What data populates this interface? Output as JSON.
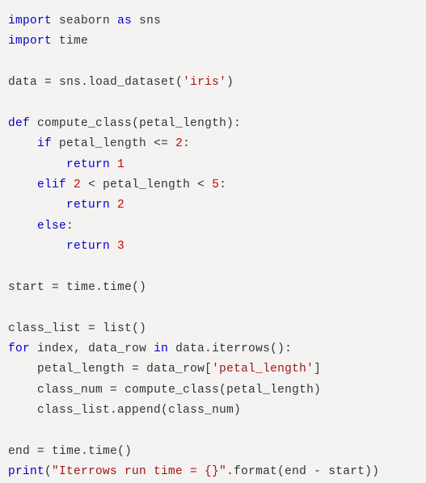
{
  "code": {
    "lines": [
      {
        "indent": 0,
        "tokens": [
          {
            "t": "kw",
            "v": "import"
          },
          {
            "t": "sp",
            "v": " "
          },
          {
            "t": "id",
            "v": "seaborn"
          },
          {
            "t": "sp",
            "v": " "
          },
          {
            "t": "kw",
            "v": "as"
          },
          {
            "t": "sp",
            "v": " "
          },
          {
            "t": "id",
            "v": "sns"
          }
        ]
      },
      {
        "indent": 0,
        "tokens": [
          {
            "t": "kw",
            "v": "import"
          },
          {
            "t": "sp",
            "v": " "
          },
          {
            "t": "id",
            "v": "time"
          }
        ]
      },
      {
        "blank": true
      },
      {
        "indent": 0,
        "tokens": [
          {
            "t": "id",
            "v": "data"
          },
          {
            "t": "sp",
            "v": " "
          },
          {
            "t": "op",
            "v": "="
          },
          {
            "t": "sp",
            "v": " "
          },
          {
            "t": "id",
            "v": "sns.load_dataset"
          },
          {
            "t": "op",
            "v": "("
          },
          {
            "t": "str",
            "v": "'iris'"
          },
          {
            "t": "op",
            "v": ")"
          }
        ]
      },
      {
        "blank": true
      },
      {
        "indent": 0,
        "tokens": [
          {
            "t": "kw",
            "v": "def"
          },
          {
            "t": "sp",
            "v": " "
          },
          {
            "t": "id",
            "v": "compute_class"
          },
          {
            "t": "op",
            "v": "("
          },
          {
            "t": "id",
            "v": "petal_length"
          },
          {
            "t": "op",
            "v": "):"
          }
        ]
      },
      {
        "indent": 1,
        "tokens": [
          {
            "t": "kw",
            "v": "if"
          },
          {
            "t": "sp",
            "v": " "
          },
          {
            "t": "id",
            "v": "petal_length"
          },
          {
            "t": "sp",
            "v": " "
          },
          {
            "t": "op",
            "v": "<="
          },
          {
            "t": "sp",
            "v": " "
          },
          {
            "t": "num",
            "v": "2"
          },
          {
            "t": "op",
            "v": ":"
          }
        ]
      },
      {
        "indent": 2,
        "tokens": [
          {
            "t": "kw",
            "v": "return"
          },
          {
            "t": "sp",
            "v": " "
          },
          {
            "t": "num",
            "v": "1"
          }
        ]
      },
      {
        "indent": 1,
        "tokens": [
          {
            "t": "kw",
            "v": "elif"
          },
          {
            "t": "sp",
            "v": " "
          },
          {
            "t": "num",
            "v": "2"
          },
          {
            "t": "sp",
            "v": " "
          },
          {
            "t": "op",
            "v": "<"
          },
          {
            "t": "sp",
            "v": " "
          },
          {
            "t": "id",
            "v": "petal_length"
          },
          {
            "t": "sp",
            "v": " "
          },
          {
            "t": "op",
            "v": "<"
          },
          {
            "t": "sp",
            "v": " "
          },
          {
            "t": "num",
            "v": "5"
          },
          {
            "t": "op",
            "v": ":"
          }
        ]
      },
      {
        "indent": 2,
        "tokens": [
          {
            "t": "kw",
            "v": "return"
          },
          {
            "t": "sp",
            "v": " "
          },
          {
            "t": "num",
            "v": "2"
          }
        ]
      },
      {
        "indent": 1,
        "tokens": [
          {
            "t": "kw",
            "v": "else"
          },
          {
            "t": "op",
            "v": ":"
          }
        ]
      },
      {
        "indent": 2,
        "tokens": [
          {
            "t": "kw",
            "v": "return"
          },
          {
            "t": "sp",
            "v": " "
          },
          {
            "t": "num",
            "v": "3"
          }
        ]
      },
      {
        "blank": true
      },
      {
        "indent": 0,
        "tokens": [
          {
            "t": "id",
            "v": "start"
          },
          {
            "t": "sp",
            "v": " "
          },
          {
            "t": "op",
            "v": "="
          },
          {
            "t": "sp",
            "v": " "
          },
          {
            "t": "id",
            "v": "time.time"
          },
          {
            "t": "op",
            "v": "()"
          }
        ]
      },
      {
        "blank": true
      },
      {
        "indent": 0,
        "tokens": [
          {
            "t": "id",
            "v": "class_list"
          },
          {
            "t": "sp",
            "v": " "
          },
          {
            "t": "op",
            "v": "="
          },
          {
            "t": "sp",
            "v": " "
          },
          {
            "t": "id",
            "v": "list"
          },
          {
            "t": "op",
            "v": "()"
          }
        ]
      },
      {
        "indent": 0,
        "tokens": [
          {
            "t": "kw",
            "v": "for"
          },
          {
            "t": "sp",
            "v": " "
          },
          {
            "t": "id",
            "v": "index"
          },
          {
            "t": "op",
            "v": ","
          },
          {
            "t": "sp",
            "v": " "
          },
          {
            "t": "id",
            "v": "data_row"
          },
          {
            "t": "sp",
            "v": " "
          },
          {
            "t": "kw",
            "v": "in"
          },
          {
            "t": "sp",
            "v": " "
          },
          {
            "t": "id",
            "v": "data.iterrows"
          },
          {
            "t": "op",
            "v": "():"
          }
        ]
      },
      {
        "indent": 1,
        "tokens": [
          {
            "t": "id",
            "v": "petal_length"
          },
          {
            "t": "sp",
            "v": " "
          },
          {
            "t": "op",
            "v": "="
          },
          {
            "t": "sp",
            "v": " "
          },
          {
            "t": "id",
            "v": "data_row"
          },
          {
            "t": "op",
            "v": "["
          },
          {
            "t": "str",
            "v": "'petal_length'"
          },
          {
            "t": "op",
            "v": "]"
          }
        ]
      },
      {
        "indent": 1,
        "tokens": [
          {
            "t": "id",
            "v": "class_num"
          },
          {
            "t": "sp",
            "v": " "
          },
          {
            "t": "op",
            "v": "="
          },
          {
            "t": "sp",
            "v": " "
          },
          {
            "t": "id",
            "v": "compute_class"
          },
          {
            "t": "op",
            "v": "("
          },
          {
            "t": "id",
            "v": "petal_length"
          },
          {
            "t": "op",
            "v": ")"
          }
        ]
      },
      {
        "indent": 1,
        "tokens": [
          {
            "t": "id",
            "v": "class_list.append"
          },
          {
            "t": "op",
            "v": "("
          },
          {
            "t": "id",
            "v": "class_num"
          },
          {
            "t": "op",
            "v": ")"
          }
        ]
      },
      {
        "blank": true
      },
      {
        "indent": 0,
        "tokens": [
          {
            "t": "id",
            "v": "end"
          },
          {
            "t": "sp",
            "v": " "
          },
          {
            "t": "op",
            "v": "="
          },
          {
            "t": "sp",
            "v": " "
          },
          {
            "t": "id",
            "v": "time.time"
          },
          {
            "t": "op",
            "v": "()"
          }
        ]
      },
      {
        "indent": 0,
        "tokens": [
          {
            "t": "kw",
            "v": "print"
          },
          {
            "t": "op",
            "v": "("
          },
          {
            "t": "str",
            "v": "\"Iterrows run time = {}\""
          },
          {
            "t": "op",
            "v": "."
          },
          {
            "t": "id",
            "v": "format"
          },
          {
            "t": "op",
            "v": "("
          },
          {
            "t": "id",
            "v": "end"
          },
          {
            "t": "sp",
            "v": " "
          },
          {
            "t": "op",
            "v": "-"
          },
          {
            "t": "sp",
            "v": " "
          },
          {
            "t": "id",
            "v": "start"
          },
          {
            "t": "op",
            "v": "))"
          }
        ]
      }
    ]
  }
}
